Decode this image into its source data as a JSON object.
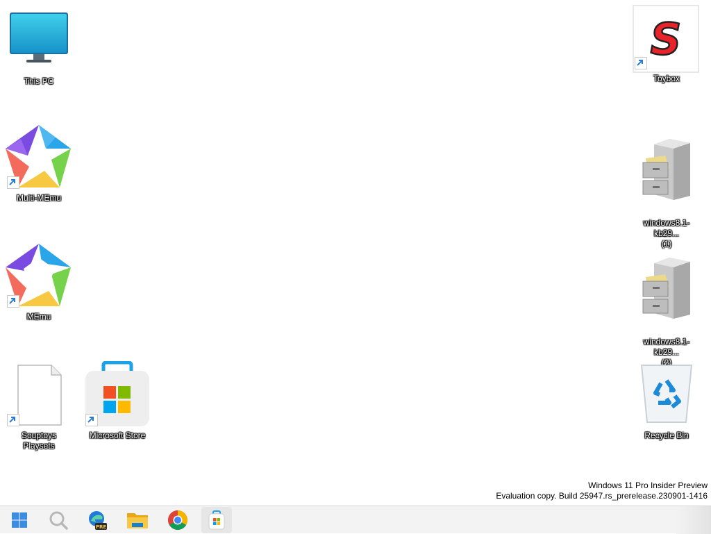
{
  "desktop": {
    "left_icons": [
      {
        "label": "This PC"
      },
      {
        "label": "Multi-MEmu"
      },
      {
        "label": "MEmu"
      },
      {
        "label": "Souptoys Playsets"
      },
      {
        "label": "Microsoft Store"
      }
    ],
    "right_icons": [
      {
        "label": "Toybox"
      },
      {
        "label": "windows8.1-kb29...\n(1)"
      },
      {
        "label": "windows8.1-kb29...\n(2)"
      },
      {
        "label": "Recycle Bin"
      }
    ]
  },
  "watermark": {
    "line1": "Windows 11 Pro Insider Preview",
    "line2": "Evaluation copy. Build 25947.rs_prerelease.230901-1416"
  },
  "taskbar": {
    "buttons": [
      {
        "name": "start-icon"
      },
      {
        "name": "search-icon"
      },
      {
        "name": "edge-preview-icon",
        "badge": "PRE"
      },
      {
        "name": "file-explorer-icon"
      },
      {
        "name": "chrome-icon"
      },
      {
        "name": "microsoft-store-icon"
      }
    ]
  },
  "colors": {
    "taskbar_bg": "#f3f3f3",
    "desktop_bg": "#ffffff",
    "shortcut_arrow": "#2a7bd6"
  }
}
